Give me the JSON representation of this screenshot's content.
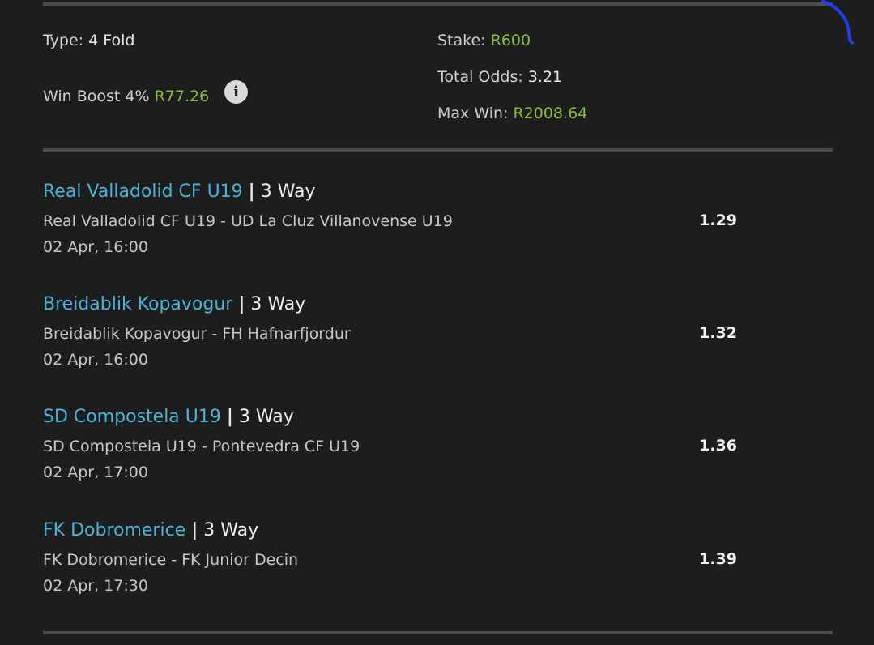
{
  "summary": {
    "type_label": "Type:",
    "type_value": "4 Fold",
    "boost_label": "Win Boost 4%",
    "boost_value": "R77.26",
    "stake_label": "Stake:",
    "stake_value": "R600",
    "odds_label": "Total Odds:",
    "odds_value": "3.21",
    "maxwin_label": "Max Win:",
    "maxwin_value": "R2008.64",
    "info_icon_glyph": "i"
  },
  "selections": [
    {
      "team": "Real Valladolid CF U19",
      "separator": "|",
      "market": "3 Way",
      "match": "Real Valladolid CF U19 - UD La Cluz Villanovense U19",
      "date": "02 Apr, 16:00",
      "odds": "1.29"
    },
    {
      "team": "Breidablik Kopavogur",
      "separator": "|",
      "market": "3 Way",
      "match": "Breidablik Kopavogur - FH Hafnarfjordur",
      "date": "02 Apr, 16:00",
      "odds": "1.32"
    },
    {
      "team": "SD Compostela U19",
      "separator": "|",
      "market": "3 Way",
      "match": "SD Compostela U19 - Pontevedra CF U19",
      "date": "02 Apr, 17:00",
      "odds": "1.36"
    },
    {
      "team": "FK Dobromerice",
      "separator": "|",
      "market": "3 Way",
      "match": "FK Dobromerice - FK Junior Decin",
      "date": "02 Apr, 17:30",
      "odds": "1.39"
    }
  ],
  "colors": {
    "background": "#1d1d1e",
    "accent_link": "#4ab3d9",
    "money_green": "#8bbd3c",
    "scribble_blue": "#1f3fe0"
  }
}
